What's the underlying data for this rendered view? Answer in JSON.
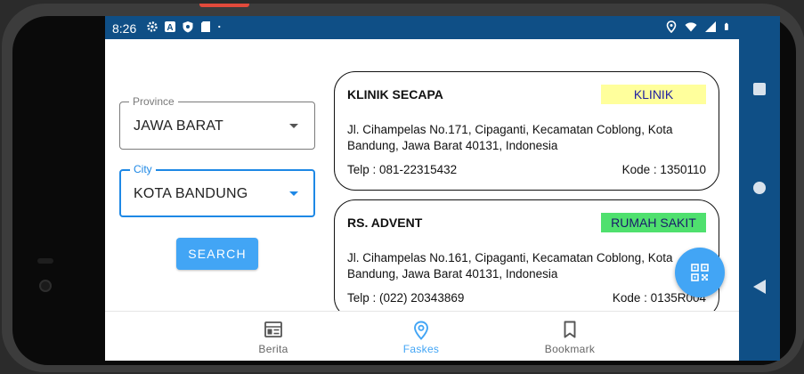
{
  "status_bar": {
    "time": "8:26",
    "left_icons": [
      "gear-icon",
      "a-icon",
      "shield-icon",
      "sd-card-icon",
      "dot-icon"
    ],
    "right_icons": [
      "location-icon",
      "wifi-icon",
      "signal-icon",
      "battery-icon"
    ]
  },
  "form": {
    "province": {
      "label": "Province",
      "value": "JAWA BARAT"
    },
    "city": {
      "label": "City",
      "value": "KOTA BANDUNG"
    },
    "search_label": "SEARCH"
  },
  "results": [
    {
      "name": "KLINIK SECAPA",
      "type": "KLINIK",
      "address": "Jl. Cihampelas No.171, Cipaganti, Kecamatan Coblong, Kota Bandung, Jawa Barat 40131, Indonesia",
      "telp": "Telp : 081-22315432",
      "kode": "Kode : 1350110"
    },
    {
      "name": "RS. ADVENT",
      "type": "RUMAH SAKIT",
      "address": "Jl. Cihampelas No.161, Cipaganti, Kecamatan Coblong, Kota Bandung, Jawa Barat 40131, Indonesia",
      "telp": "Telp : (022) 20343869",
      "kode": "Kode : 0135R004"
    }
  ],
  "bottom_nav": {
    "items": [
      {
        "label": "Berita",
        "icon": "newspaper-icon",
        "active": false
      },
      {
        "label": "Faskes",
        "icon": "location-pin-icon",
        "active": true
      },
      {
        "label": "Bookmark",
        "icon": "bookmark-icon",
        "active": false
      }
    ]
  },
  "colors": {
    "accent": "#42a5f5",
    "status_bar": "#0f4f86",
    "klinik_badge": "#ffff9c",
    "rumah_sakit_badge": "#4fe06e"
  }
}
